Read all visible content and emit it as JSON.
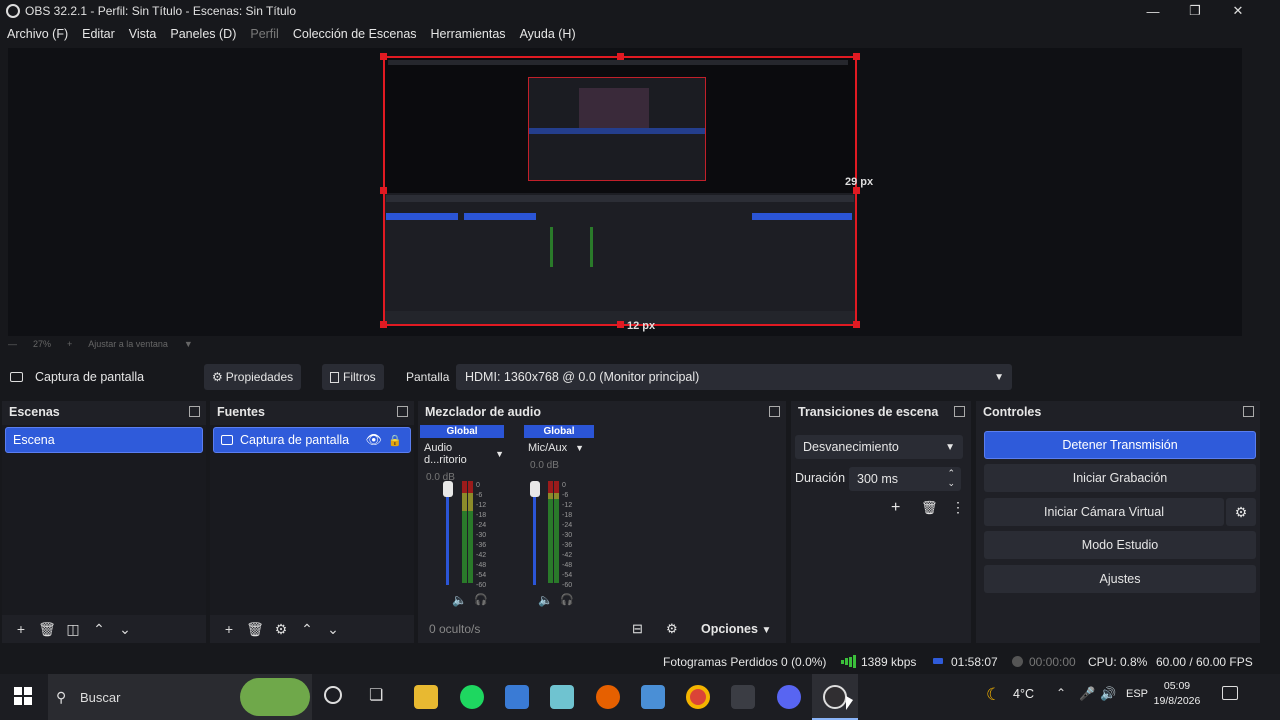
{
  "window": {
    "title": "OBS 32.2.1 - Perfil: Sin Título - Escenas: Sin Título"
  },
  "menu": [
    {
      "label": "Archivo (F)",
      "disabled": false
    },
    {
      "label": "Editar",
      "disabled": false
    },
    {
      "label": "Vista",
      "disabled": false
    },
    {
      "label": "Paneles (D)",
      "disabled": false
    },
    {
      "label": "Perfil",
      "disabled": true
    },
    {
      "label": "Colección de Escenas",
      "disabled": false
    },
    {
      "label": "Herramientas",
      "disabled": false
    },
    {
      "label": "Ayuda (H)",
      "disabled": false
    }
  ],
  "preview": {
    "right_gap": "29 px",
    "bottom_gap": "12 px",
    "zoom": "27%",
    "fit_label": "Ajustar a la ventana"
  },
  "context": {
    "source_name": "Captura de pantalla",
    "properties": "Propiedades",
    "filters": "Filtros",
    "display_label": "Pantalla",
    "display_value": "HDMI: 1360x768 @ 0.0 (Monitor principal)"
  },
  "scenes": {
    "title": "Escenas",
    "items": [
      "Escena"
    ]
  },
  "sources": {
    "title": "Fuentes",
    "items": [
      "Captura de pantalla"
    ]
  },
  "mixer": {
    "title": "Mezclador de audio",
    "channels": [
      {
        "badge": "Global",
        "name": "Audio d...ritorio",
        "db": "0.0 dB"
      },
      {
        "badge": "Global",
        "name": "Mic/Aux",
        "db": "0.0 dB"
      }
    ],
    "scale": [
      "0",
      "-6",
      "-12",
      "-18",
      "-24",
      "-30",
      "-36",
      "-42",
      "-48",
      "-54",
      "-60"
    ],
    "hidden": "0 oculto/s",
    "options": "Opciones"
  },
  "transitions": {
    "title": "Transiciones de escena",
    "selected": "Desvanecimiento",
    "duration_label": "Duración",
    "duration_value": "300 ms"
  },
  "controls": {
    "title": "Controles",
    "stop_stream": "Detener Transmisión",
    "start_record": "Iniciar Grabación",
    "virtual_cam": "Iniciar Cámara Virtual",
    "studio_mode": "Modo Estudio",
    "settings": "Ajustes"
  },
  "status": {
    "dropped": "Fotogramas Perdidos 0 (0.0%)",
    "bitrate": "1389 kbps",
    "stream_time": "01:58:07",
    "rec_time": "00:00:00",
    "cpu": "CPU: 0.8%",
    "fps": "60.00 / 60.00 FPS"
  },
  "taskbar": {
    "search": "Buscar",
    "temp": "4°C",
    "lang": "ESP",
    "time": "05:09",
    "date": "19/8/2026"
  },
  "colors": {
    "accent": "#2f5bda",
    "selection": "#e01a22",
    "bg": "#17181c"
  }
}
